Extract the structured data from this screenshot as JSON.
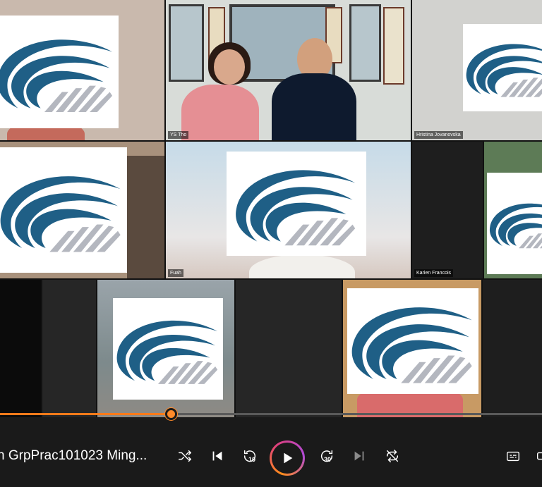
{
  "player": {
    "title": "n GrpPrac101023 Ming...",
    "progress_fraction": 0.315,
    "accent_color": "#ff7a1a",
    "controls": {
      "shuffle_icon": "shuffle-icon",
      "previous_icon": "skip-previous-icon",
      "rewind_label": "10",
      "play_icon": "play-icon",
      "forward_label": "30",
      "next_icon": "skip-next-icon",
      "repeat_icon": "repeat-icon",
      "captions_icon": "captions-icon"
    }
  },
  "meeting": {
    "tiles": [
      {
        "id": "logo-top-left",
        "name": ""
      },
      {
        "id": "video-couple",
        "name": "YS Tho"
      },
      {
        "id": "logo-top-right",
        "name": "Hristina Jovanovska"
      },
      {
        "id": "logo-mid-left",
        "name": ""
      },
      {
        "id": "logo-center",
        "name": "Fuah"
      },
      {
        "id": "dark-tile",
        "name": "Karien Francois"
      },
      {
        "id": "logo-mid-right",
        "name": ""
      },
      {
        "id": "logo-bottom-left",
        "name": ""
      },
      {
        "id": "logo-bottom-right",
        "name": ""
      }
    ],
    "logo_colors": {
      "blue": "#1f5f86",
      "gray": "#b4b7bf"
    }
  }
}
